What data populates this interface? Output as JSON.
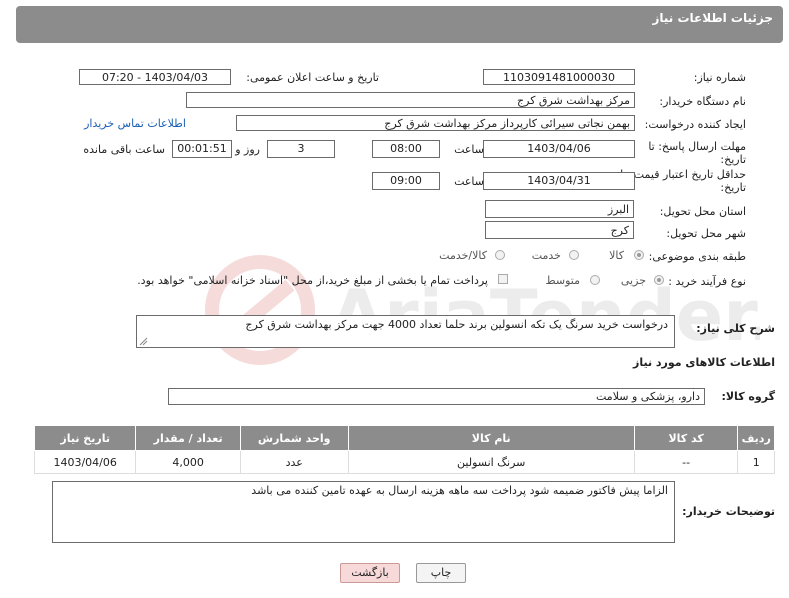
{
  "header": {
    "title": "جزئیات اطلاعات نیاز"
  },
  "fields": {
    "need_number_label": "شماره نیاز:",
    "need_number": "1103091481000030",
    "announce_label": "تاریخ و ساعت اعلان عمومی:",
    "announce_value": "1403/04/03 - 07:20",
    "buyer_org_label": "نام دستگاه خریدار:",
    "buyer_org": "مرکز بهداشت شرق کرج",
    "creator_label": "ایجاد کننده درخواست:",
    "creator": "بهمن  نجاتی سیرائی کارپرداز مرکز بهداشت شرق کرج",
    "contact_link": "اطلاعات تماس خریدار",
    "deadline_label_1": "مهلت ارسال پاسخ: تا",
    "deadline_label_2": "تاریخ:",
    "deadline_date": "1403/04/06",
    "time_label": "ساعت",
    "deadline_time": "08:00",
    "days_value": "3",
    "days_label": "روز و",
    "remaining_value": "00:01:51",
    "remaining_label": "ساعت باقی مانده",
    "price_valid_label_1": "حداقل تاریخ اعتبار قیمت: تا",
    "price_valid_label_2": "تاریخ:",
    "price_valid_date": "1403/04/31",
    "price_valid_time": "09:00",
    "province_label": "استان محل تحویل:",
    "province": "البرز",
    "city_label": "شهر محل تحویل:",
    "city": "کرج",
    "category_label": "طبقه بندی موضوعی:",
    "category_options": [
      "کالا",
      "خدمت",
      "کالا/خدمت"
    ],
    "purchase_type_label": "نوع فرآیند خرید :",
    "purchase_options": [
      "جزیی",
      "متوسط"
    ],
    "payment_note": "پرداخت تمام یا بخشی از مبلغ خرید،از محل \"اسناد خزانه اسلامی\" خواهد بود."
  },
  "description": {
    "label": "شرح کلی نیاز:",
    "text": "درخواست خرید سرنگ  یک تکه انسولین  برند حلما تعداد 4000  جهت مرکز بهداشت شرق کرج"
  },
  "goods_info_title": "اطلاعات کالاهای مورد نیاز",
  "goods_group": {
    "label": "گروه کالا:",
    "value": "دارو، پزشکی و سلامت"
  },
  "table": {
    "headers": [
      "ردیف",
      "کد کالا",
      "نام کالا",
      "واحد شمارش",
      "تعداد / مقدار",
      "تاریخ نیاز"
    ],
    "rows": [
      [
        "1",
        "--",
        "سرنگ انسولین",
        "عدد",
        "4,000",
        "1403/04/06"
      ]
    ]
  },
  "buyer_notes": {
    "label": "توضیحات خریدار:",
    "text": "الزاما پیش فاکتور ضمیمه شود پرداخت سه ماهه هزینه ارسال به عهده تامین کننده می باشد"
  },
  "buttons": {
    "print": "چاپ",
    "back": "بازگشت"
  },
  "colors": {
    "header_bg": "#8c8c8c",
    "link": "#1a5fb4",
    "back_button_bg": "#f7d9d9"
  }
}
